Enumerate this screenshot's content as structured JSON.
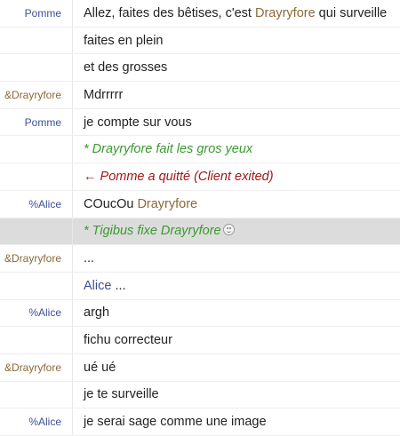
{
  "colors": {
    "nick_blue": "#3e4f97",
    "nick_brown": "#8a6a3a",
    "action_green": "#3a9a2e",
    "quit_red": "#a01818",
    "highlight_bg": "#dcdcdc"
  },
  "rows": [
    {
      "nick": "Pomme",
      "msg_a": "Allez, faites des bêtises, c'est ",
      "mention": "Drayryfore",
      "msg_b": " qui surveille"
    },
    {
      "nick": "",
      "msg": "faites en plein"
    },
    {
      "nick": "",
      "msg": "et des grosses"
    },
    {
      "nick": "&Drayryfore",
      "msg": "Mdrrrrr"
    },
    {
      "nick": "Pomme",
      "msg": "je compte sur vous"
    },
    {
      "nick": "",
      "msg": "* Drayryfore fait les gros yeux"
    },
    {
      "nick": "",
      "msg": "← Pomme a quitté (Client exited)"
    },
    {
      "nick": "%Alice",
      "msg_a": "COucOu ",
      "mention": "Drayryfore"
    },
    {
      "nick": "",
      "msg": "* Tigibus fixe Drayryfore",
      "icon": "smiley-icon"
    },
    {
      "nick": "&Drayryfore",
      "msg": "..."
    },
    {
      "nick": "",
      "mention": "Alice",
      "msg_b": " ..."
    },
    {
      "nick": "%Alice",
      "msg": "argh"
    },
    {
      "nick": "",
      "msg": "fichu correcteur"
    },
    {
      "nick": "&Drayryfore",
      "msg": "ué ué"
    },
    {
      "nick": "",
      "msg": "je te surveille"
    },
    {
      "nick": "%Alice",
      "msg": "je serai sage comme une image"
    }
  ]
}
